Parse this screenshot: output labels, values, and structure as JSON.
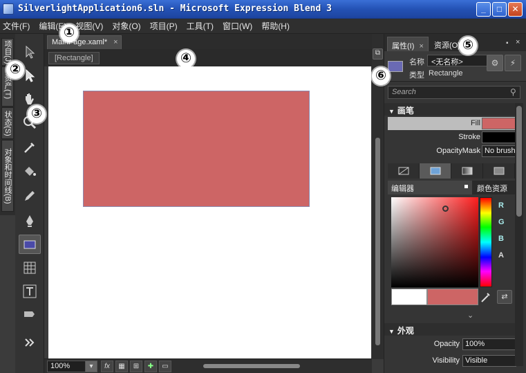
{
  "window": {
    "title": "SilverlightApplication6.sln - Microsoft Expression Blend 3",
    "min": "_",
    "max": "□",
    "close": "✕"
  },
  "menu": [
    "文件(F)",
    "编辑(E)",
    "视图(V)",
    "对象(O)",
    "项目(P)",
    "工具(T)",
    "窗口(W)",
    "帮助(H)"
  ],
  "sidetabs": [
    "项目(J)",
    "资产(T)",
    "状态(S)",
    "对象和时间线(B)"
  ],
  "tools": [
    "selection-icon",
    "direct-selection-icon",
    "pan-icon",
    "zoom-icon",
    "eyedropper-icon",
    "paint-bucket-icon",
    "pencil-icon",
    "pen-icon",
    "rectangle-icon",
    "grid-icon",
    "text-icon",
    "asset-icon",
    "more-icon"
  ],
  "document": {
    "tab_label": "MainPage.xaml*",
    "tab_close": "×",
    "breadcrumb": "[Rectangle]"
  },
  "rectangle_color": "#cd6565",
  "bottom": {
    "zoom": "100%",
    "fx": "fx"
  },
  "panel": {
    "tab_properties": "属性(I)",
    "tab_properties_close": "×",
    "tab_resources": "资源(O)",
    "name_label": "名称",
    "name_value": "<无名称>",
    "type_label": "类型",
    "type_value": "Rectangle",
    "search_placeholder": "Search",
    "brush_section": "画笔",
    "fill_label": "Fill",
    "stroke_label": "Stroke",
    "opacitymask_label": "OpacityMask",
    "opacitymask_value": "No brush",
    "editor_tab": "编辑器",
    "color_res_tab": "颜色资源",
    "r": "R",
    "g": "G",
    "b": "B",
    "a": "A",
    "appearance_section": "外观",
    "opacity_label": "Opacity",
    "opacity_value": "100%",
    "visibility_label": "Visibility",
    "visibility_value": "Visible"
  },
  "badges": [
    "①",
    "②",
    "③",
    "④",
    "⑤",
    "⑥"
  ]
}
